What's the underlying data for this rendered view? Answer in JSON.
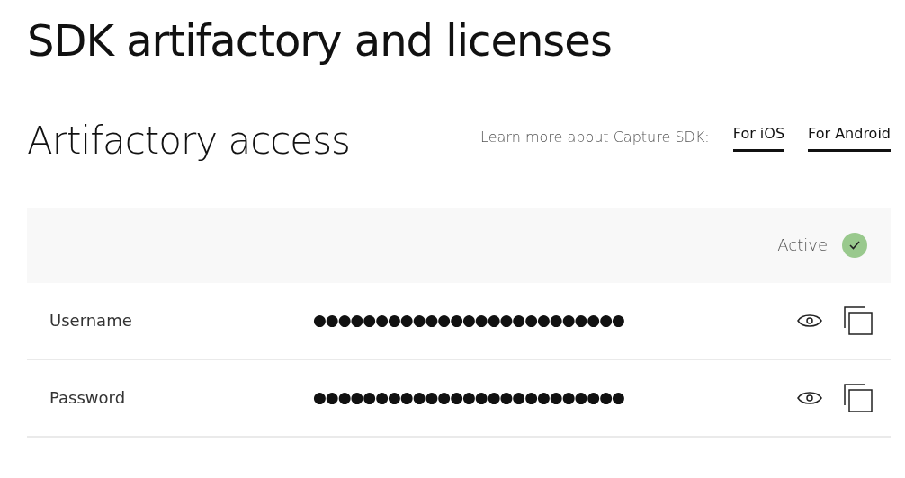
{
  "page_title": "SDK artifactory and licenses",
  "section": {
    "title": "Artifactory access",
    "learn_more": "Learn more about Capture SDK:",
    "links": [
      {
        "label": "For iOS"
      },
      {
        "label": "For Android"
      }
    ]
  },
  "status": {
    "label": "Active",
    "active": true
  },
  "credentials": [
    {
      "label": "Username",
      "value": "●●●●●●●●●●●●●●●●●●●●●●●●●"
    },
    {
      "label": "Password",
      "value": "●●●●●●●●●●●●●●●●●●●●●●●●●"
    }
  ]
}
